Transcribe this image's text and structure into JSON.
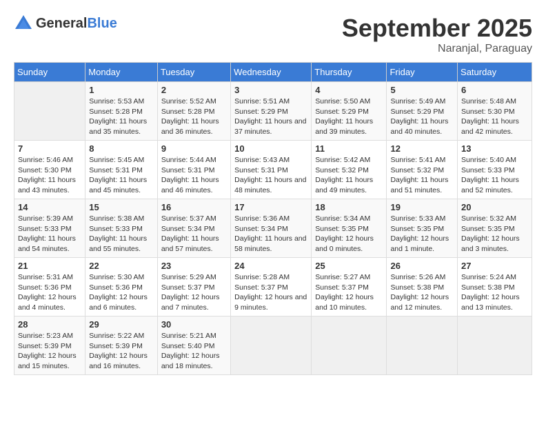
{
  "header": {
    "logo_general": "General",
    "logo_blue": "Blue",
    "month": "September 2025",
    "location": "Naranjal, Paraguay"
  },
  "days_of_week": [
    "Sunday",
    "Monday",
    "Tuesday",
    "Wednesday",
    "Thursday",
    "Friday",
    "Saturday"
  ],
  "weeks": [
    [
      {
        "day": "",
        "sunrise": "",
        "sunset": "",
        "daylight": ""
      },
      {
        "day": "1",
        "sunrise": "Sunrise: 5:53 AM",
        "sunset": "Sunset: 5:28 PM",
        "daylight": "Daylight: 11 hours and 35 minutes."
      },
      {
        "day": "2",
        "sunrise": "Sunrise: 5:52 AM",
        "sunset": "Sunset: 5:28 PM",
        "daylight": "Daylight: 11 hours and 36 minutes."
      },
      {
        "day": "3",
        "sunrise": "Sunrise: 5:51 AM",
        "sunset": "Sunset: 5:29 PM",
        "daylight": "Daylight: 11 hours and 37 minutes."
      },
      {
        "day": "4",
        "sunrise": "Sunrise: 5:50 AM",
        "sunset": "Sunset: 5:29 PM",
        "daylight": "Daylight: 11 hours and 39 minutes."
      },
      {
        "day": "5",
        "sunrise": "Sunrise: 5:49 AM",
        "sunset": "Sunset: 5:29 PM",
        "daylight": "Daylight: 11 hours and 40 minutes."
      },
      {
        "day": "6",
        "sunrise": "Sunrise: 5:48 AM",
        "sunset": "Sunset: 5:30 PM",
        "daylight": "Daylight: 11 hours and 42 minutes."
      }
    ],
    [
      {
        "day": "7",
        "sunrise": "Sunrise: 5:46 AM",
        "sunset": "Sunset: 5:30 PM",
        "daylight": "Daylight: 11 hours and 43 minutes."
      },
      {
        "day": "8",
        "sunrise": "Sunrise: 5:45 AM",
        "sunset": "Sunset: 5:31 PM",
        "daylight": "Daylight: 11 hours and 45 minutes."
      },
      {
        "day": "9",
        "sunrise": "Sunrise: 5:44 AM",
        "sunset": "Sunset: 5:31 PM",
        "daylight": "Daylight: 11 hours and 46 minutes."
      },
      {
        "day": "10",
        "sunrise": "Sunrise: 5:43 AM",
        "sunset": "Sunset: 5:31 PM",
        "daylight": "Daylight: 11 hours and 48 minutes."
      },
      {
        "day": "11",
        "sunrise": "Sunrise: 5:42 AM",
        "sunset": "Sunset: 5:32 PM",
        "daylight": "Daylight: 11 hours and 49 minutes."
      },
      {
        "day": "12",
        "sunrise": "Sunrise: 5:41 AM",
        "sunset": "Sunset: 5:32 PM",
        "daylight": "Daylight: 11 hours and 51 minutes."
      },
      {
        "day": "13",
        "sunrise": "Sunrise: 5:40 AM",
        "sunset": "Sunset: 5:33 PM",
        "daylight": "Daylight: 11 hours and 52 minutes."
      }
    ],
    [
      {
        "day": "14",
        "sunrise": "Sunrise: 5:39 AM",
        "sunset": "Sunset: 5:33 PM",
        "daylight": "Daylight: 11 hours and 54 minutes."
      },
      {
        "day": "15",
        "sunrise": "Sunrise: 5:38 AM",
        "sunset": "Sunset: 5:33 PM",
        "daylight": "Daylight: 11 hours and 55 minutes."
      },
      {
        "day": "16",
        "sunrise": "Sunrise: 5:37 AM",
        "sunset": "Sunset: 5:34 PM",
        "daylight": "Daylight: 11 hours and 57 minutes."
      },
      {
        "day": "17",
        "sunrise": "Sunrise: 5:36 AM",
        "sunset": "Sunset: 5:34 PM",
        "daylight": "Daylight: 11 hours and 58 minutes."
      },
      {
        "day": "18",
        "sunrise": "Sunrise: 5:34 AM",
        "sunset": "Sunset: 5:35 PM",
        "daylight": "Daylight: 12 hours and 0 minutes."
      },
      {
        "day": "19",
        "sunrise": "Sunrise: 5:33 AM",
        "sunset": "Sunset: 5:35 PM",
        "daylight": "Daylight: 12 hours and 1 minute."
      },
      {
        "day": "20",
        "sunrise": "Sunrise: 5:32 AM",
        "sunset": "Sunset: 5:35 PM",
        "daylight": "Daylight: 12 hours and 3 minutes."
      }
    ],
    [
      {
        "day": "21",
        "sunrise": "Sunrise: 5:31 AM",
        "sunset": "Sunset: 5:36 PM",
        "daylight": "Daylight: 12 hours and 4 minutes."
      },
      {
        "day": "22",
        "sunrise": "Sunrise: 5:30 AM",
        "sunset": "Sunset: 5:36 PM",
        "daylight": "Daylight: 12 hours and 6 minutes."
      },
      {
        "day": "23",
        "sunrise": "Sunrise: 5:29 AM",
        "sunset": "Sunset: 5:37 PM",
        "daylight": "Daylight: 12 hours and 7 minutes."
      },
      {
        "day": "24",
        "sunrise": "Sunrise: 5:28 AM",
        "sunset": "Sunset: 5:37 PM",
        "daylight": "Daylight: 12 hours and 9 minutes."
      },
      {
        "day": "25",
        "sunrise": "Sunrise: 5:27 AM",
        "sunset": "Sunset: 5:37 PM",
        "daylight": "Daylight: 12 hours and 10 minutes."
      },
      {
        "day": "26",
        "sunrise": "Sunrise: 5:26 AM",
        "sunset": "Sunset: 5:38 PM",
        "daylight": "Daylight: 12 hours and 12 minutes."
      },
      {
        "day": "27",
        "sunrise": "Sunrise: 5:24 AM",
        "sunset": "Sunset: 5:38 PM",
        "daylight": "Daylight: 12 hours and 13 minutes."
      }
    ],
    [
      {
        "day": "28",
        "sunrise": "Sunrise: 5:23 AM",
        "sunset": "Sunset: 5:39 PM",
        "daylight": "Daylight: 12 hours and 15 minutes."
      },
      {
        "day": "29",
        "sunrise": "Sunrise: 5:22 AM",
        "sunset": "Sunset: 5:39 PM",
        "daylight": "Daylight: 12 hours and 16 minutes."
      },
      {
        "day": "30",
        "sunrise": "Sunrise: 5:21 AM",
        "sunset": "Sunset: 5:40 PM",
        "daylight": "Daylight: 12 hours and 18 minutes."
      },
      {
        "day": "",
        "sunrise": "",
        "sunset": "",
        "daylight": ""
      },
      {
        "day": "",
        "sunrise": "",
        "sunset": "",
        "daylight": ""
      },
      {
        "day": "",
        "sunrise": "",
        "sunset": "",
        "daylight": ""
      },
      {
        "day": "",
        "sunrise": "",
        "sunset": "",
        "daylight": ""
      }
    ]
  ]
}
